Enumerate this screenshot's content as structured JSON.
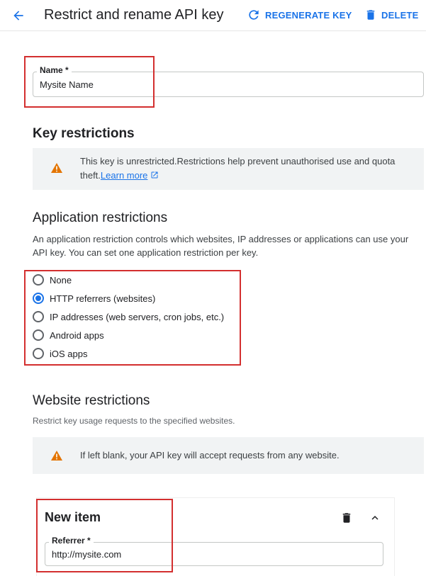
{
  "header": {
    "title": "Restrict and rename API key",
    "regenerate_label": "REGENERATE KEY",
    "delete_label": "DELETE"
  },
  "name_field": {
    "label": "Name *",
    "value": "Mysite Name"
  },
  "key_restrictions": {
    "heading": "Key restrictions",
    "warning_line1": "This key is unrestricted.Restrictions help prevent unauthorised use and quota",
    "warning_line2": "theft.",
    "learn_more": "Learn more"
  },
  "application_restrictions": {
    "heading": "Application restrictions",
    "description_line1": "An application restriction controls which websites, IP addresses or applications can use your",
    "description_line2": "API key. You can set one application restriction per key.",
    "options": [
      {
        "label": "None",
        "checked": false
      },
      {
        "label": "HTTP referrers (websites)",
        "checked": true
      },
      {
        "label": "IP addresses (web servers, cron jobs, etc.)",
        "checked": false
      },
      {
        "label": "Android apps",
        "checked": false
      },
      {
        "label": "iOS apps",
        "checked": false
      }
    ]
  },
  "website_restrictions": {
    "heading": "Website restrictions",
    "description": "Restrict key usage requests to the specified websites.",
    "warning": "If left blank, your API key will accept requests from any website."
  },
  "new_item": {
    "title": "New item",
    "referrer_label": "Referrer *",
    "referrer_value": "http://mysite.com"
  },
  "colors": {
    "accent": "#1a73e8",
    "warning": "#e37400",
    "highlight_border": "#d32f2f"
  }
}
